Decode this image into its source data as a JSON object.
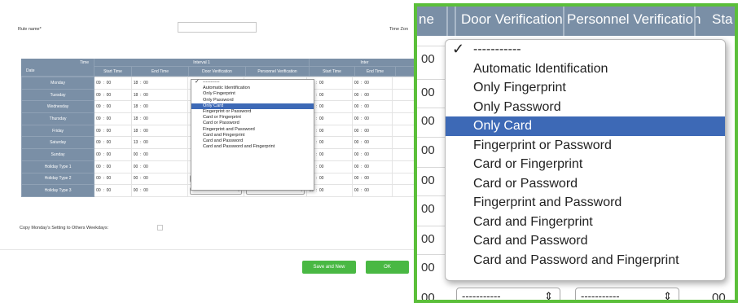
{
  "form": {
    "rule_name_label": "Rule name*",
    "rule_name_value": "",
    "time_zone_label": "Time Zon",
    "table_corner_top": "Time",
    "table_corner_bottom": "Date",
    "interval1_label": "Interval 1",
    "interval2_label": "Inter",
    "col_start_time": "Start Time",
    "col_end_time": "End Time",
    "col_door_verification": "Door Verification",
    "col_personnel_verification": "Personnel Verification",
    "col_start_time2": "Start Time",
    "col_end_time2": "End Time",
    "rows": [
      {
        "day": "Monday",
        "s_h": "09",
        "s_m": "00",
        "e_h": "18",
        "e_m": "00"
      },
      {
        "day": "Tuesday",
        "s_h": "09",
        "s_m": "00",
        "e_h": "18",
        "e_m": "00"
      },
      {
        "day": "Wednesday",
        "s_h": "09",
        "s_m": "00",
        "e_h": "18",
        "e_m": "00"
      },
      {
        "day": "Thursday",
        "s_h": "09",
        "s_m": "00",
        "e_h": "18",
        "e_m": "00"
      },
      {
        "day": "Friday",
        "s_h": "09",
        "s_m": "00",
        "e_h": "18",
        "e_m": "00"
      },
      {
        "day": "Saturday",
        "s_h": "09",
        "s_m": "00",
        "e_h": "13",
        "e_m": "00"
      },
      {
        "day": "Sunday",
        "s_h": "00",
        "s_m": "00",
        "e_h": "00",
        "e_m": "00"
      },
      {
        "day": "Holiday Type 1",
        "s_h": "00",
        "s_m": "00",
        "e_h": "00",
        "e_m": "00"
      },
      {
        "day": "Holiday Type 2",
        "s_h": "00",
        "s_m": "00",
        "e_h": "00",
        "e_m": "00"
      },
      {
        "day": "Holiday Type 3",
        "s_h": "00",
        "s_m": "00",
        "e_h": "00",
        "e_m": "00"
      }
    ],
    "interval2_values": {
      "s_h": "00",
      "s_m": "00",
      "e_h": "00",
      "e_m": "00"
    },
    "select_placeholder": "---------",
    "copy_label": "Copy Monday's Setting to Others Weekdays:",
    "save_new_label": "Save and New",
    "ok_label": "OK"
  },
  "dropdown": {
    "selected_index": 4,
    "options": [
      "-----------",
      "Automatic Identification",
      "Only Fingerprint",
      "Only Password",
      "Only Card",
      "Fingerprint or Password",
      "Card or Fingerprint",
      "Card or Password",
      "Fingerprint and Password",
      "Card and Fingerprint",
      "Card and Password",
      "Card and Password and Fingerprint"
    ]
  },
  "zoom": {
    "head_partial": "ne",
    "head_door": "Door Verification",
    "head_personnel": "Personnel Verification",
    "head_status": "Sta",
    "time_cells": [
      "00",
      "00",
      "00",
      "00",
      "00",
      "00",
      "00",
      "00",
      "00",
      "00",
      "00",
      "00"
    ],
    "bottom_select_1": "-----------",
    "bottom_select_2": "-----------",
    "bottom_time": "00"
  },
  "colors": {
    "header_bg": "#7a8fa6",
    "highlight": "#3d69b6",
    "button_green": "#49b843",
    "zoom_border": "#5bbf3a"
  }
}
